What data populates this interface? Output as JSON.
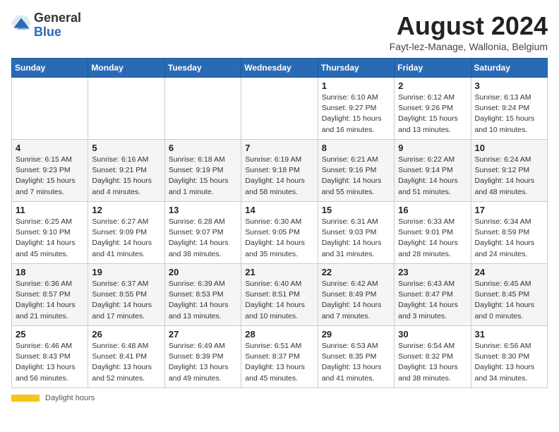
{
  "header": {
    "logo_line1": "General",
    "logo_line2": "Blue",
    "main_title": "August 2024",
    "subtitle": "Fayt-lez-Manage, Wallonia, Belgium"
  },
  "days_of_week": [
    "Sunday",
    "Monday",
    "Tuesday",
    "Wednesday",
    "Thursday",
    "Friday",
    "Saturday"
  ],
  "weeks": [
    [
      {
        "day": "",
        "info": ""
      },
      {
        "day": "",
        "info": ""
      },
      {
        "day": "",
        "info": ""
      },
      {
        "day": "",
        "info": ""
      },
      {
        "day": "1",
        "info": "Sunrise: 6:10 AM\nSunset: 9:27 PM\nDaylight: 15 hours and 16 minutes."
      },
      {
        "day": "2",
        "info": "Sunrise: 6:12 AM\nSunset: 9:26 PM\nDaylight: 15 hours and 13 minutes."
      },
      {
        "day": "3",
        "info": "Sunrise: 6:13 AM\nSunset: 9:24 PM\nDaylight: 15 hours and 10 minutes."
      }
    ],
    [
      {
        "day": "4",
        "info": "Sunrise: 6:15 AM\nSunset: 9:23 PM\nDaylight: 15 hours and 7 minutes."
      },
      {
        "day": "5",
        "info": "Sunrise: 6:16 AM\nSunset: 9:21 PM\nDaylight: 15 hours and 4 minutes."
      },
      {
        "day": "6",
        "info": "Sunrise: 6:18 AM\nSunset: 9:19 PM\nDaylight: 15 hours and 1 minute."
      },
      {
        "day": "7",
        "info": "Sunrise: 6:19 AM\nSunset: 9:18 PM\nDaylight: 14 hours and 58 minutes."
      },
      {
        "day": "8",
        "info": "Sunrise: 6:21 AM\nSunset: 9:16 PM\nDaylight: 14 hours and 55 minutes."
      },
      {
        "day": "9",
        "info": "Sunrise: 6:22 AM\nSunset: 9:14 PM\nDaylight: 14 hours and 51 minutes."
      },
      {
        "day": "10",
        "info": "Sunrise: 6:24 AM\nSunset: 9:12 PM\nDaylight: 14 hours and 48 minutes."
      }
    ],
    [
      {
        "day": "11",
        "info": "Sunrise: 6:25 AM\nSunset: 9:10 PM\nDaylight: 14 hours and 45 minutes."
      },
      {
        "day": "12",
        "info": "Sunrise: 6:27 AM\nSunset: 9:09 PM\nDaylight: 14 hours and 41 minutes."
      },
      {
        "day": "13",
        "info": "Sunrise: 6:28 AM\nSunset: 9:07 PM\nDaylight: 14 hours and 38 minutes."
      },
      {
        "day": "14",
        "info": "Sunrise: 6:30 AM\nSunset: 9:05 PM\nDaylight: 14 hours and 35 minutes."
      },
      {
        "day": "15",
        "info": "Sunrise: 6:31 AM\nSunset: 9:03 PM\nDaylight: 14 hours and 31 minutes."
      },
      {
        "day": "16",
        "info": "Sunrise: 6:33 AM\nSunset: 9:01 PM\nDaylight: 14 hours and 28 minutes."
      },
      {
        "day": "17",
        "info": "Sunrise: 6:34 AM\nSunset: 8:59 PM\nDaylight: 14 hours and 24 minutes."
      }
    ],
    [
      {
        "day": "18",
        "info": "Sunrise: 6:36 AM\nSunset: 8:57 PM\nDaylight: 14 hours and 21 minutes."
      },
      {
        "day": "19",
        "info": "Sunrise: 6:37 AM\nSunset: 8:55 PM\nDaylight: 14 hours and 17 minutes."
      },
      {
        "day": "20",
        "info": "Sunrise: 6:39 AM\nSunset: 8:53 PM\nDaylight: 14 hours and 13 minutes."
      },
      {
        "day": "21",
        "info": "Sunrise: 6:40 AM\nSunset: 8:51 PM\nDaylight: 14 hours and 10 minutes."
      },
      {
        "day": "22",
        "info": "Sunrise: 6:42 AM\nSunset: 8:49 PM\nDaylight: 14 hours and 7 minutes."
      },
      {
        "day": "23",
        "info": "Sunrise: 6:43 AM\nSunset: 8:47 PM\nDaylight: 14 hours and 3 minutes."
      },
      {
        "day": "24",
        "info": "Sunrise: 6:45 AM\nSunset: 8:45 PM\nDaylight: 14 hours and 0 minutes."
      }
    ],
    [
      {
        "day": "25",
        "info": "Sunrise: 6:46 AM\nSunset: 8:43 PM\nDaylight: 13 hours and 56 minutes."
      },
      {
        "day": "26",
        "info": "Sunrise: 6:48 AM\nSunset: 8:41 PM\nDaylight: 13 hours and 52 minutes."
      },
      {
        "day": "27",
        "info": "Sunrise: 6:49 AM\nSunset: 8:39 PM\nDaylight: 13 hours and 49 minutes."
      },
      {
        "day": "28",
        "info": "Sunrise: 6:51 AM\nSunset: 8:37 PM\nDaylight: 13 hours and 45 minutes."
      },
      {
        "day": "29",
        "info": "Sunrise: 6:53 AM\nSunset: 8:35 PM\nDaylight: 13 hours and 41 minutes."
      },
      {
        "day": "30",
        "info": "Sunrise: 6:54 AM\nSunset: 8:32 PM\nDaylight: 13 hours and 38 minutes."
      },
      {
        "day": "31",
        "info": "Sunrise: 6:56 AM\nSunset: 8:30 PM\nDaylight: 13 hours and 34 minutes."
      }
    ]
  ],
  "footer": {
    "daylight_label": "Daylight hours"
  }
}
